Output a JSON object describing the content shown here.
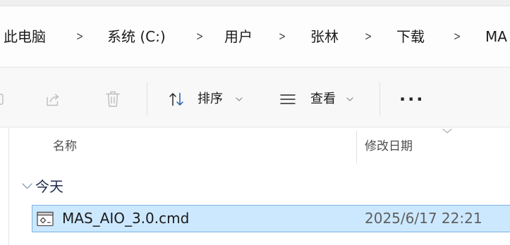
{
  "address_bar": {
    "breadcrumb": [
      "此电脑",
      "系统 (C:)",
      "用户",
      "张林",
      "下载",
      "MA"
    ],
    "separator": ">"
  },
  "command_bar": {
    "rename": {
      "icon": "rename-icon",
      "enabled": false
    },
    "share": {
      "icon": "share-icon",
      "enabled": false
    },
    "delete": {
      "icon": "delete-icon",
      "enabled": false
    },
    "sort": {
      "label": "排序",
      "icon": "sort-icon",
      "dropdown_icon": "chevron-down-icon"
    },
    "view": {
      "label": "查看",
      "icon": "view-icon",
      "dropdown_icon": "chevron-down-icon"
    },
    "more": {
      "label": "···",
      "icon": "more-icon"
    }
  },
  "file_list": {
    "columns": [
      {
        "label": "名称"
      },
      {
        "label": "修改日期",
        "sort_indicator": "chevron-down-icon"
      }
    ],
    "groups": [
      {
        "label": "今天",
        "expanded": true,
        "toggle_icon": "chevron-down-icon",
        "items": [
          {
            "name": "MAS_AIO_3.0.cmd",
            "modified": "2025/6/17 22:21",
            "icon": "cmd-file-icon",
            "selected": true
          }
        ]
      }
    ]
  },
  "theme": {
    "selection_background": "#cce8ff",
    "selection_border": "#7ab3e6",
    "disabled_icon": "#bdbdbd",
    "text_primary": "#1b1b1b",
    "text_secondary": "#5f5f5f",
    "group_header_text": "#1e2b4d"
  }
}
